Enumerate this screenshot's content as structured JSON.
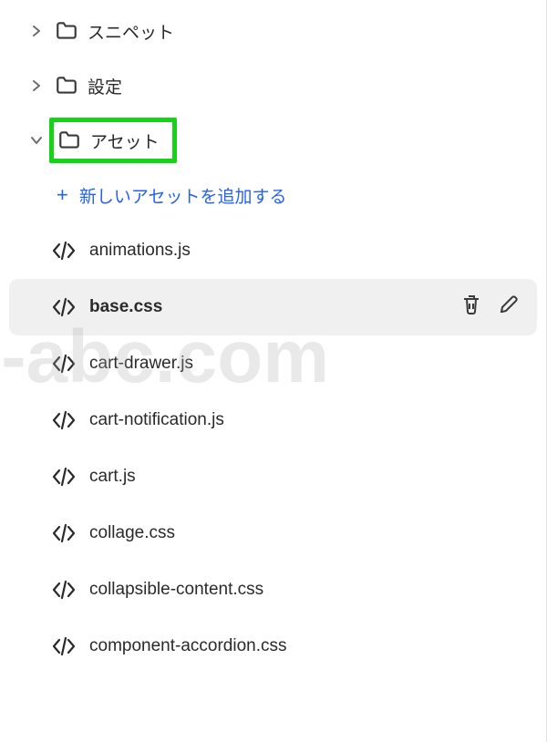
{
  "watermark": "ec-abc.com",
  "folders": {
    "snippets": {
      "label": "スニペット",
      "expanded": false
    },
    "settings": {
      "label": "設定",
      "expanded": false
    },
    "assets": {
      "label": "アセット",
      "expanded": true
    }
  },
  "add_asset": {
    "label": "新しいアセットを追加する",
    "plus": "+"
  },
  "files": [
    {
      "name": "animations.js",
      "selected": false
    },
    {
      "name": "base.css",
      "selected": true
    },
    {
      "name": "cart-drawer.js",
      "selected": false
    },
    {
      "name": "cart-notification.js",
      "selected": false
    },
    {
      "name": "cart.js",
      "selected": false
    },
    {
      "name": "collage.css",
      "selected": false
    },
    {
      "name": "collapsible-content.css",
      "selected": false
    },
    {
      "name": "component-accordion.css",
      "selected": false
    }
  ],
  "icons": {
    "delete": "delete",
    "edit": "edit"
  }
}
